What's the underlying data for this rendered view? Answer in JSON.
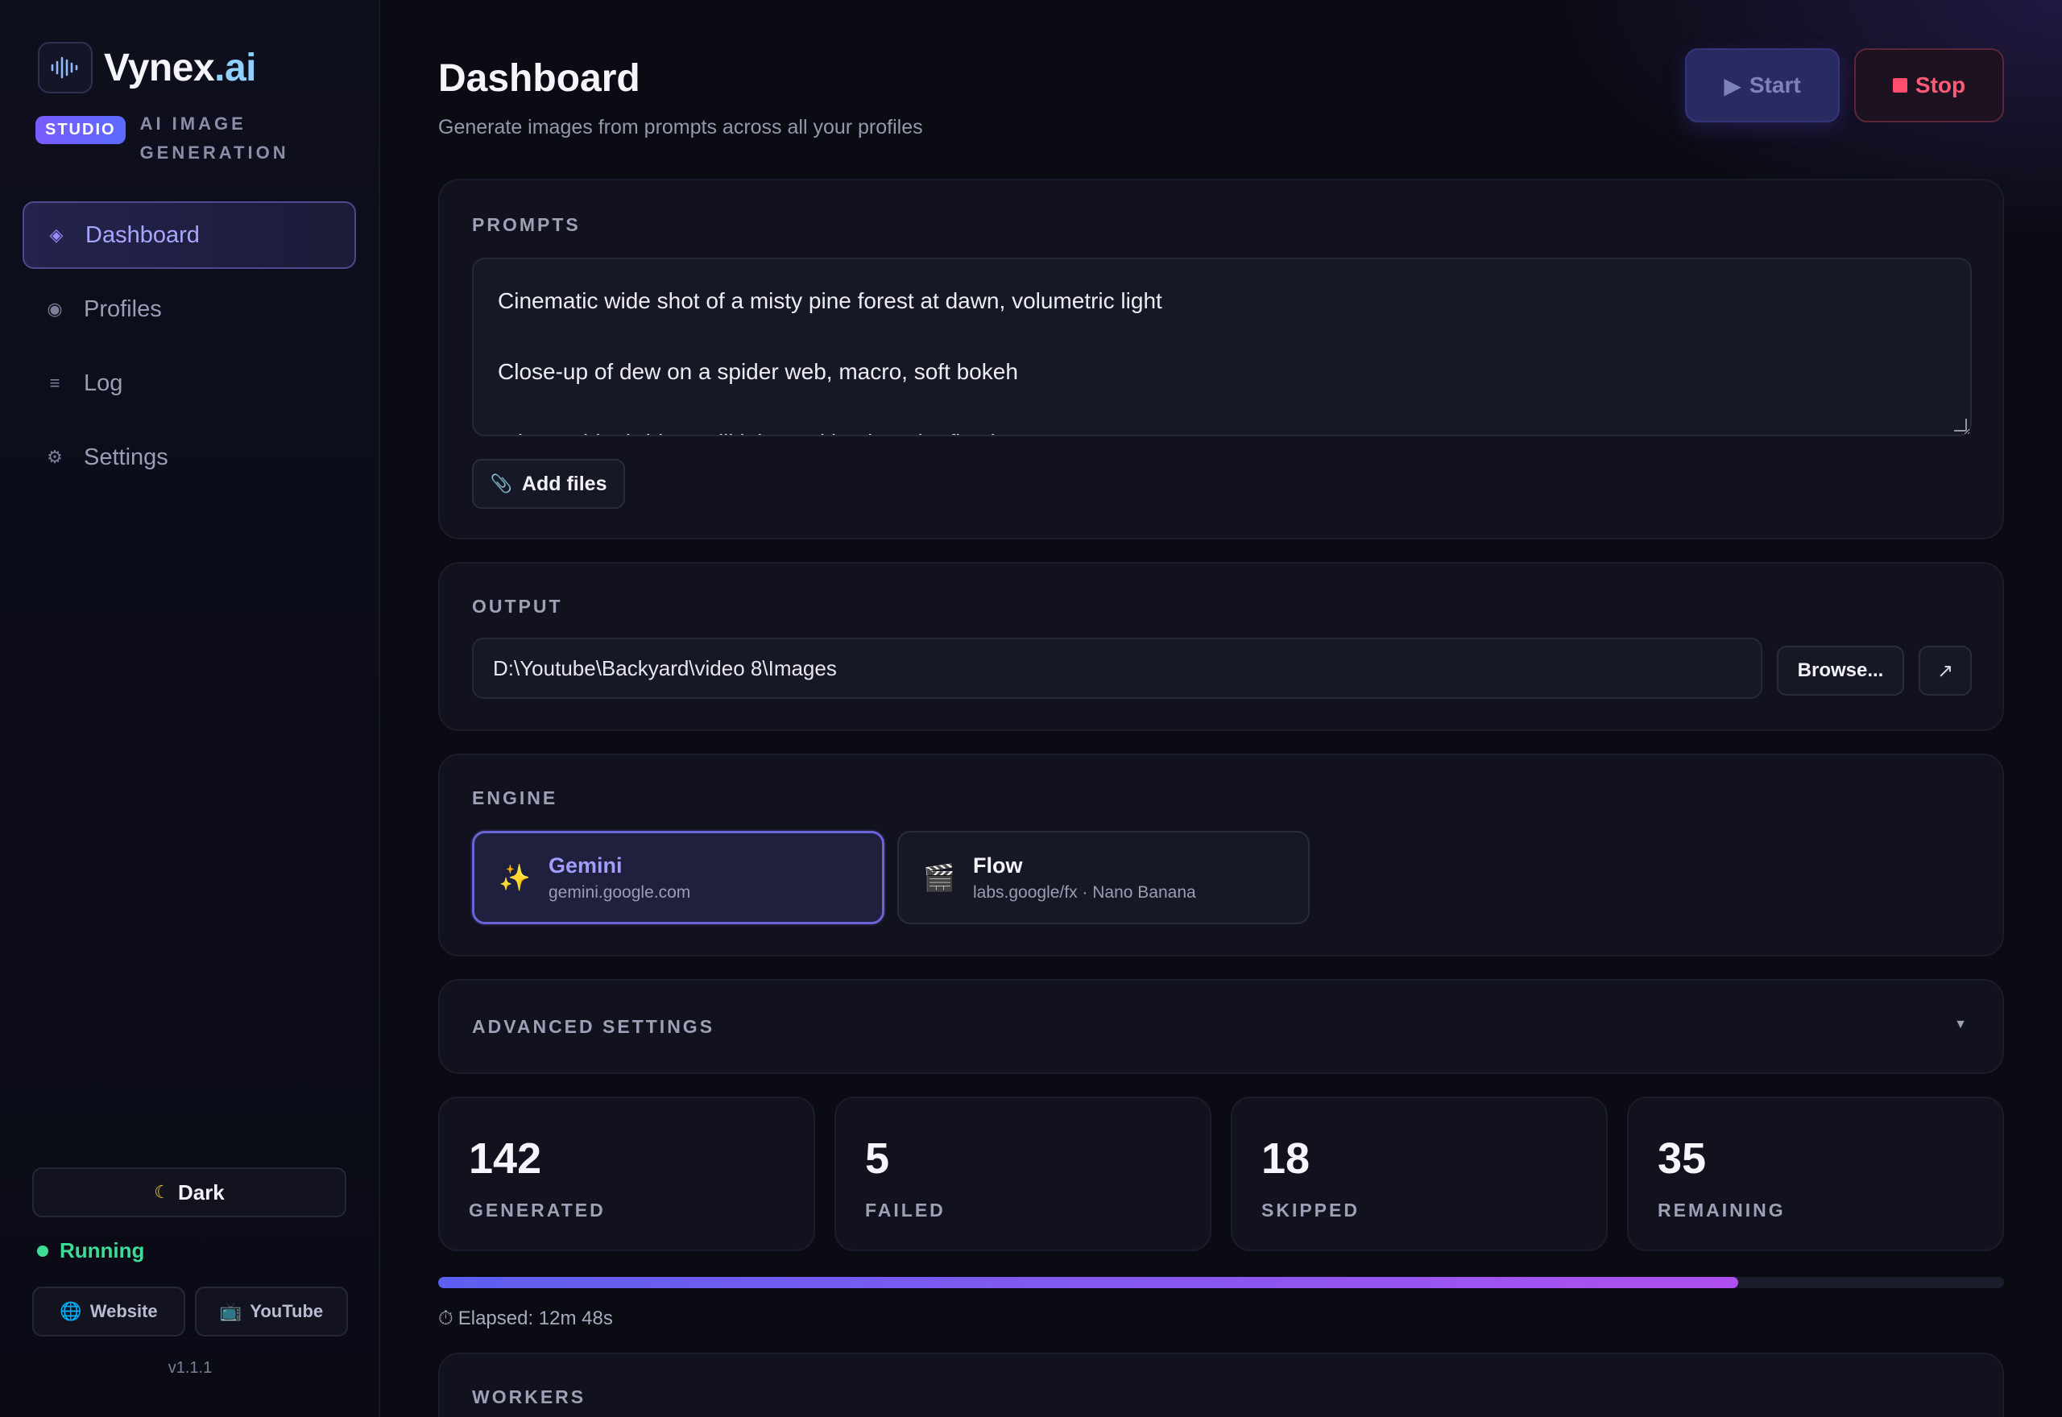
{
  "brand": {
    "name": "Vynex",
    "name_suffix": ".ai",
    "badge": "STUDIO",
    "subtitle_line1": "AI IMAGE",
    "subtitle_line2": "GENERATION"
  },
  "nav": [
    {
      "label": "Dashboard",
      "icon": "diamond-icon",
      "active": true
    },
    {
      "label": "Profiles",
      "icon": "circle-icon",
      "active": false
    },
    {
      "label": "Log",
      "icon": "list-icon",
      "active": false
    },
    {
      "label": "Settings",
      "icon": "gear-icon",
      "active": false
    }
  ],
  "sidebar_footer": {
    "theme_label": "Dark",
    "status": "Running",
    "website_label": "Website",
    "youtube_label": "YouTube",
    "version": "v1.1.1"
  },
  "header": {
    "title": "Dashboard",
    "subtitle": "Generate images from prompts across all your profiles",
    "start_label": "Start",
    "stop_label": "Stop"
  },
  "prompts": {
    "label": "PROMPTS",
    "lines": [
      "Cinematic wide shot of a misty pine forest at dawn, volumetric light",
      "Close-up of dew on a spider web, macro, soft bokeh",
      "A lone white bridge, still lake and backyard reflection"
    ],
    "add_files_label": "Add files"
  },
  "output": {
    "label": "OUTPUT",
    "path": "D:\\Youtube\\Backyard\\video 8\\Images",
    "browse_label": "Browse...",
    "open_icon": "↗"
  },
  "engine": {
    "label": "ENGINE",
    "options": [
      {
        "name": "Gemini",
        "url": "gemini.google.com",
        "emoji": "✨",
        "selected": true
      },
      {
        "name": "Flow",
        "url": "labs.google/fx · Nano Banana",
        "emoji": "🎬",
        "selected": false
      }
    ]
  },
  "advanced": {
    "label": "ADVANCED SETTINGS"
  },
  "stats": [
    {
      "value": "142",
      "label": "GENERATED"
    },
    {
      "value": "5",
      "label": "FAILED"
    },
    {
      "value": "18",
      "label": "SKIPPED"
    },
    {
      "value": "35",
      "label": "REMAINING"
    }
  ],
  "progress": {
    "fraction": 0.83
  },
  "elapsed": {
    "text": "Elapsed: 12m 48s",
    "icon": "⏱"
  },
  "workers": {
    "label": "WORKERS"
  },
  "colors": {
    "accent": "#7a6cff",
    "running": "#3ddc97",
    "stop": "#ff4d6d"
  }
}
